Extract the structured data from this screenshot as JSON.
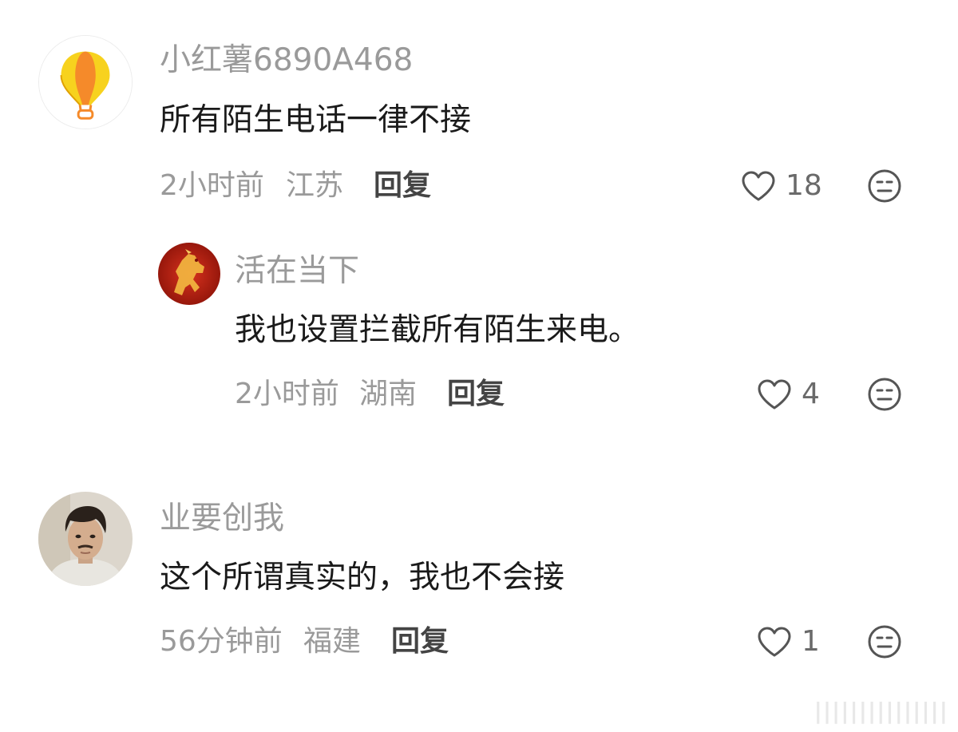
{
  "comments": [
    {
      "username": "小红薯6890A468",
      "text": "所有陌生电话一律不接",
      "time": "2小时前",
      "location": "江苏",
      "reply_label": "回复",
      "likes": "18",
      "avatar_icon": "hot-air-balloon-icon"
    },
    {
      "username": "活在当下",
      "text": "我也设置拦截所有陌生来电。",
      "time": "2小时前",
      "location": "湖南",
      "reply_label": "回复",
      "likes": "4",
      "avatar_icon": "golden-horse-avatar"
    },
    {
      "username": "业要创我",
      "text": "这个所谓真实的，我也不会接",
      "time": "56分钟前",
      "location": "福建",
      "reply_label": "回复",
      "likes": "1",
      "avatar_icon": "man-portrait-avatar"
    }
  ],
  "watermark": "|||||||||||||||",
  "colors": {
    "username": "#9a9a9a",
    "text": "#1a1a1a",
    "meta": "#9a9a9a",
    "reply": "#444444",
    "icon": "#555555"
  }
}
